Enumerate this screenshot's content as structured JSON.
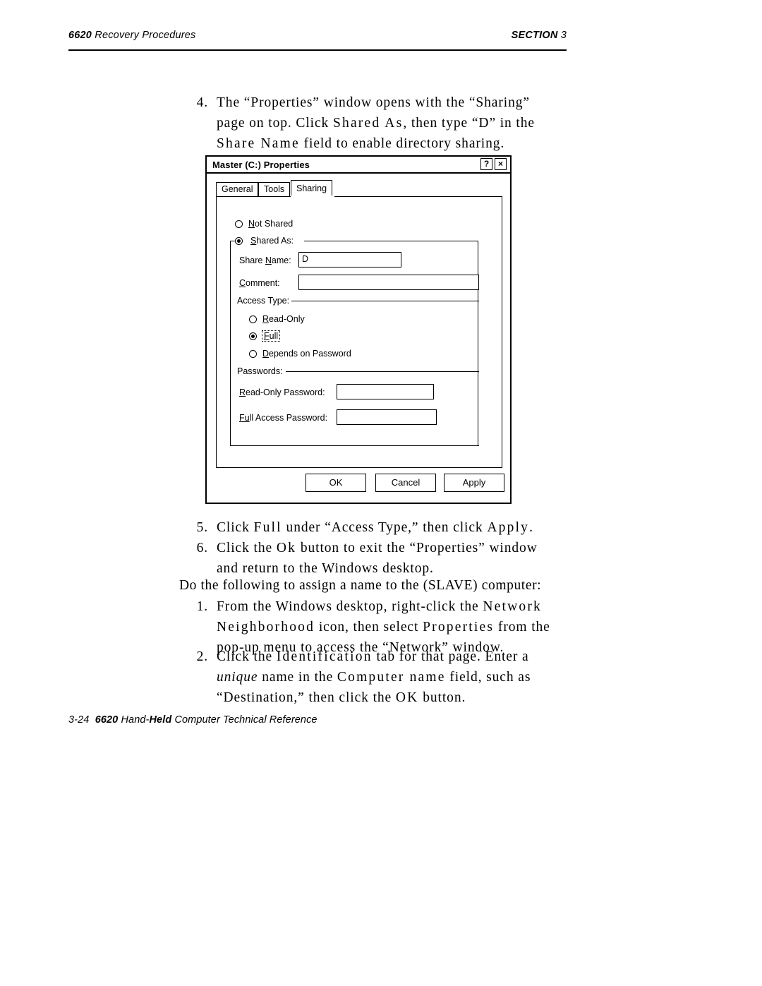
{
  "header": {
    "left_bold": "6620",
    "left_rest": " Recovery Procedures",
    "right_label": "SECTION",
    "right_number": "3"
  },
  "body": {
    "step4_num": "4.",
    "step4_line1": "The “Properties” window opens with the “Sharing”",
    "step4_line2_a": "page on top. Click ",
    "step4_line2_b": "Shared As",
    "step4_line2_c": ", then type “D” in the",
    "step4_line3_a": "Share Name",
    "step4_line3_b": " field to enable directory sharing.",
    "step5_num": "5.",
    "step5_a": "Click ",
    "step5_b": "Full",
    "step5_c": " under “Access Type,” then click ",
    "step5_d": "Apply",
    "step5_e": ".",
    "step6_num": "6.",
    "step6_line1_a": "Click the ",
    "step6_line1_b": "Ok",
    "step6_line1_c": " button to exit the “Properties” window",
    "step6_line2": "and return to the Windows desktop.",
    "slave_para": "Do the following to assign a name to the (SLAVE) computer:",
    "s1_num": "1.",
    "s1_line1_a": "From the Windows desktop, right-click the ",
    "s1_line1_b": "Network",
    "s1_line2_a": "Neighborhood",
    "s1_line2_b": " icon, then select ",
    "s1_line2_c": "Properties",
    "s1_line2_d": " from the",
    "s1_line3": "pop-up menu to access the “Network” window.",
    "s2_num": "2.",
    "s2_line1_a": "Click the ",
    "s2_line1_b": "Identification",
    "s2_line1_c": " tab for that page. Enter a",
    "s2_line2_a": "unique",
    "s2_line2_b": " name in the ",
    "s2_line2_c": "Computer name",
    "s2_line2_d": " field, such as",
    "s2_line3_a": "“Destination,” then click the ",
    "s2_line3_b": "OK",
    "s2_line3_c": " button."
  },
  "dialog": {
    "title": "Master (C:) Properties",
    "help_button": "?",
    "close_button": "×",
    "tabs": [
      {
        "label": "General",
        "active": false
      },
      {
        "label": "Tools",
        "active": false
      },
      {
        "label": "Sharing",
        "active": true
      }
    ],
    "not_shared": {
      "label_a": "N",
      "label_b": "ot Shared",
      "selected": false
    },
    "shared_as": {
      "label_a": "S",
      "label_b": "hared As:",
      "selected": true
    },
    "share_name_label_a": "Share ",
    "share_name_label_b": "N",
    "share_name_label_c": "ame:",
    "share_name_value": "D",
    "comment_label_a": "C",
    "comment_label_b": "omment:",
    "comment_value": "",
    "access_type_label": "Access Type:",
    "access_options": [
      {
        "label_a": "R",
        "label_b": "ead-Only",
        "selected": false
      },
      {
        "label_a": "F",
        "label_b": "ull",
        "selected": true,
        "focused": true
      },
      {
        "label_a": "D",
        "label_b": "epends on Password",
        "selected": false
      }
    ],
    "passwords_label": "Passwords:",
    "read_only_password_label_a": "R",
    "read_only_password_label_b": "ead-Only Password:",
    "read_only_password_value": "",
    "full_access_password_label_a": "Fu",
    "full_access_password_label_b": "ll Access Password:",
    "full_access_password_value": "",
    "buttons": [
      {
        "label": "OK"
      },
      {
        "label": "Cancel"
      },
      {
        "label": "Apply"
      }
    ]
  },
  "footer": {
    "page_number": "3-24",
    "title_bold_1": "6620",
    "title_rest_1": " Hand-",
    "title_bold_2": "Held",
    "title_rest_2": " Computer Technical Reference"
  }
}
